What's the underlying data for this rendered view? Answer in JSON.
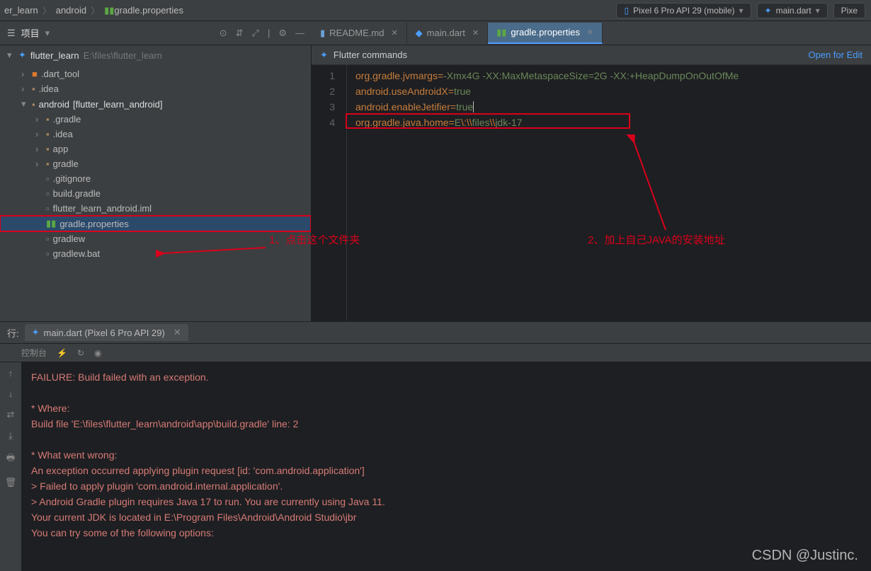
{
  "breadcrumb": {
    "root": "er_learn",
    "mid": "android",
    "file": "gradle.properties"
  },
  "device_pill": "Pixel 6 Pro API 29 (mobile)",
  "config_pill": "main.dart",
  "pixel_pill": "Pixe",
  "project_label": "项目",
  "project": {
    "name": "flutter_learn",
    "path": "E:\\files\\flutter_learn"
  },
  "tree": {
    "dart_tool": ".dart_tool",
    "idea": ".idea",
    "android": "android",
    "android_bracket": "[flutter_learn_android]",
    "gradle": ".gradle",
    "idea2": ".idea",
    "app": "app",
    "gradle2": "gradle",
    "gitignore": ".gitignore",
    "build_gradle": "build.gradle",
    "iml": "flutter_learn_android.iml",
    "gradle_props": "gradle.properties",
    "gradlew": "gradlew",
    "gradlew_bat": "gradlew.bat"
  },
  "tabs": {
    "readme": "README.md",
    "main": "main.dart",
    "gradle": "gradle.properties"
  },
  "banner": {
    "left": "Flutter commands",
    "right": "Open for Edit"
  },
  "code": {
    "l1a": "org.gradle.jvmargs",
    "l1b": "-Xmx4G -XX:MaxMetaspaceSize=2G -XX:+HeapDumpOnOutOfMe",
    "l2a": "android.useAndroidX",
    "l2b": "true",
    "l3a": "android.enableJetifier",
    "l3b": "true",
    "l4a": "org.gradle.java.home",
    "l4b": "E",
    "l4c": "\\:",
    "l4d": "\\\\",
    "l4e": "files",
    "l4f": "\\\\",
    "l4g": "jdk-17"
  },
  "anno": {
    "a1": "1、点击这个文件夹",
    "a2": "2、加上自己JAVA的安装地址"
  },
  "run": {
    "label": "行:",
    "tab": "main.dart (Pixel 6 Pro API 29)"
  },
  "console_label": "控制台",
  "console": {
    "l1": "FAILURE: Build failed with an exception.",
    "l2": "",
    "l3": "* Where:",
    "l4": "Build file 'E:\\files\\flutter_learn\\android\\app\\build.gradle' line: 2",
    "l5": "",
    "l6": "* What went wrong:",
    "l7": "An exception occurred applying plugin request [id: 'com.android.application']",
    "l8": "> Failed to apply plugin 'com.android.internal.application'.",
    "l9": "   > Android Gradle plugin requires Java 17 to run. You are currently using Java 11.",
    "l10": "      Your current JDK is located in E:\\Program Files\\Android\\Android Studio\\jbr",
    "l11": "      You can try some of the following options:"
  },
  "watermark": "CSDN @Justinc."
}
